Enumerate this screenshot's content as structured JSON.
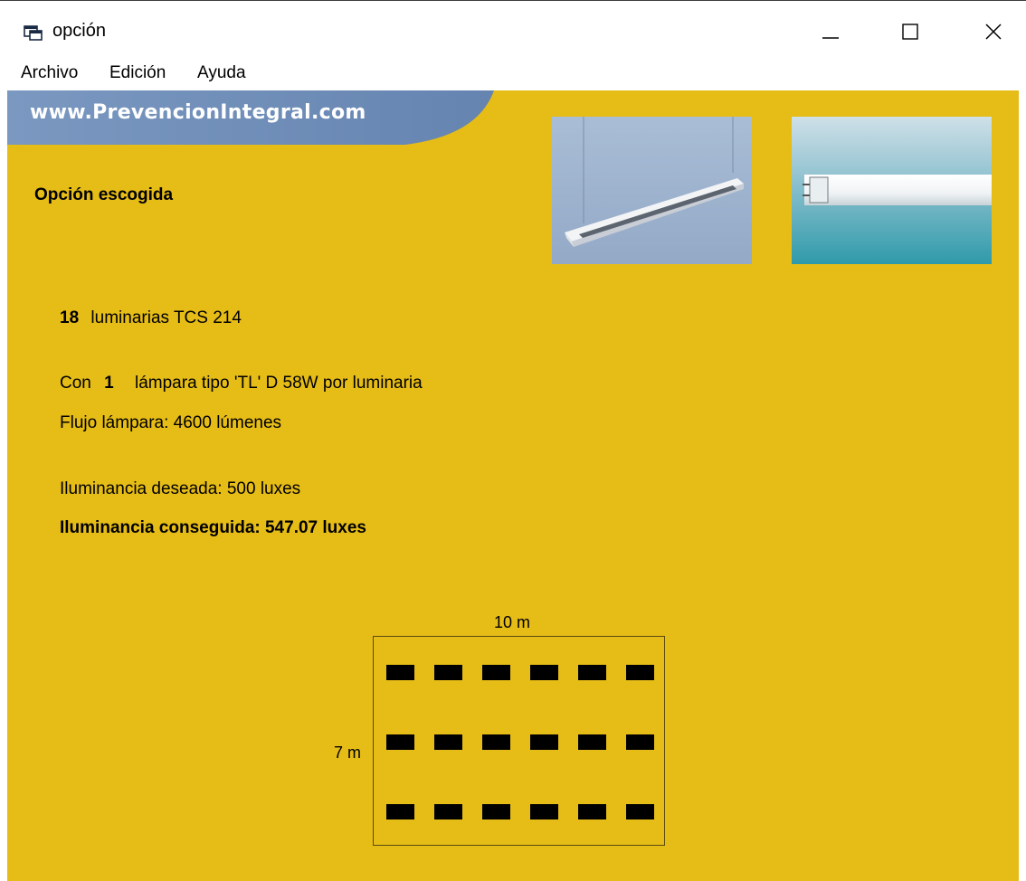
{
  "window": {
    "title": "opción",
    "icon": "app-window-icon",
    "controls": [
      "minimize-icon",
      "maximize-icon",
      "close-icon"
    ]
  },
  "menu": {
    "items": [
      {
        "label": "Archivo"
      },
      {
        "label": "Edición"
      },
      {
        "label": "Ayuda"
      }
    ]
  },
  "banner": {
    "text": "www.PrevencionIntegral.com",
    "color": "#6f8fb8"
  },
  "main": {
    "heading": "Opción escogida",
    "luminaire_count": "18",
    "luminaire_label": "luminarias TCS 214",
    "lamps_prefix": "Con",
    "lamps_count": "1",
    "lamps_label": "lámpara tipo 'TL' D 58W por luminaria",
    "lamp_flux": "Flujo lámpara: 4600 lúmenes",
    "desired_illuminance": "Iluminancia deseada: 500 luxes",
    "achieved_illuminance": "Iluminancia conseguida: 547.07 luxes"
  },
  "room_diagram": {
    "width_label": "10 m",
    "height_label": "7 m",
    "rows": 3,
    "cols": 6
  },
  "colors": {
    "background": "#e6bc16",
    "luminaire": "#000000"
  }
}
